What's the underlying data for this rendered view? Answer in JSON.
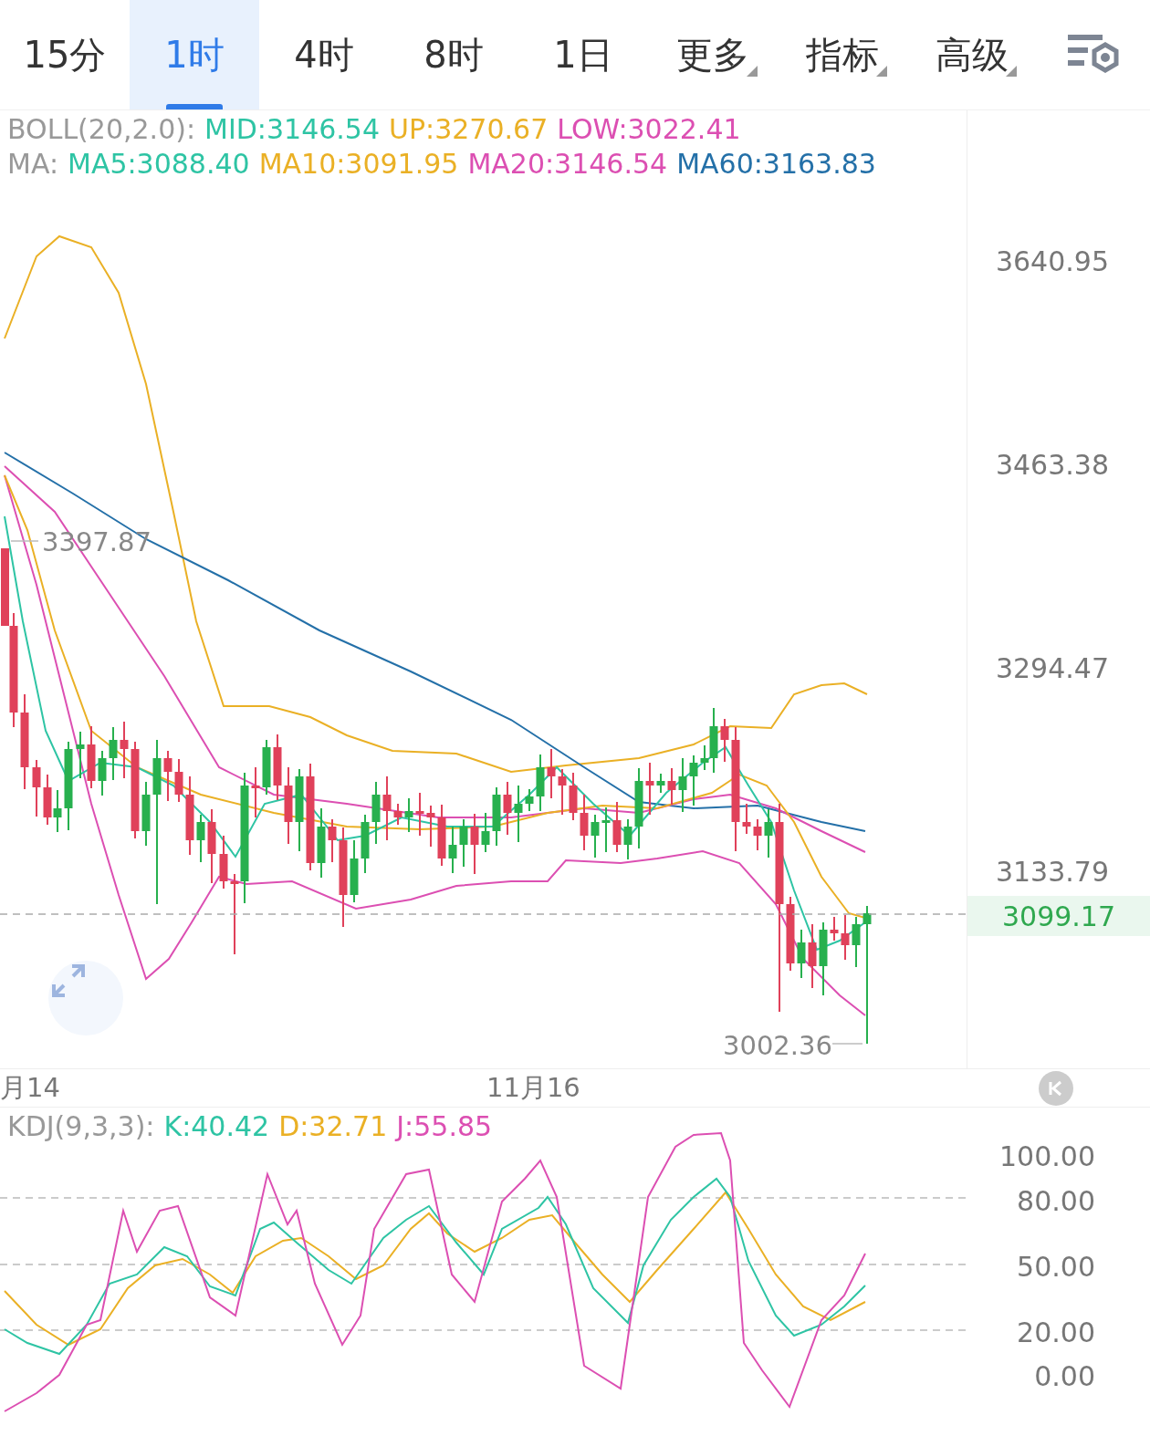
{
  "tabs": [
    {
      "label": "15分",
      "selected": false,
      "dropdown": false
    },
    {
      "label": "1时",
      "selected": true,
      "dropdown": false
    },
    {
      "label": "4时",
      "selected": false,
      "dropdown": false
    },
    {
      "label": "8时",
      "selected": false,
      "dropdown": false
    },
    {
      "label": "1日",
      "selected": false,
      "dropdown": false
    },
    {
      "label": "更多",
      "selected": false,
      "dropdown": true
    },
    {
      "label": "指标",
      "selected": false,
      "dropdown": true
    },
    {
      "label": "高级",
      "selected": false,
      "dropdown": true
    }
  ],
  "main_chart": {
    "legends": [
      {
        "label": "BOLL(20,2.0):",
        "items": [
          {
            "text": "MID:3146.54",
            "color": "#2ec4a4"
          },
          {
            "text": "UP:3270.67",
            "color": "#eab025"
          },
          {
            "text": "LOW:3022.41",
            "color": "#dc4fb2"
          }
        ]
      },
      {
        "label": "MA:",
        "items": [
          {
            "text": "MA5:3088.40",
            "color": "#2ec4a4"
          },
          {
            "text": "MA10:3091.95",
            "color": "#eab025"
          },
          {
            "text": "MA20:3146.54",
            "color": "#dc4fb2"
          },
          {
            "text": "MA60:3163.83",
            "color": "#2470a8"
          }
        ]
      }
    ],
    "price_axis": [
      "3640.95",
      "3463.38",
      "3294.47",
      "3133.79"
    ],
    "current_price": "3099.17",
    "high_marker": "3397.87",
    "low_marker": "3002.36"
  },
  "time_axis": [
    "月14",
    "11月16"
  ],
  "kdj": {
    "label": "KDJ(9,3,3):",
    "items": [
      {
        "text": "K:40.42",
        "color": "#2ec4a4"
      },
      {
        "text": "D:32.71",
        "color": "#eab025"
      },
      {
        "text": "J:55.85",
        "color": "#dc4fb2"
      }
    ],
    "axis": [
      "100.00",
      "80.00",
      "50.00",
      "20.00",
      "0.00"
    ]
  }
}
